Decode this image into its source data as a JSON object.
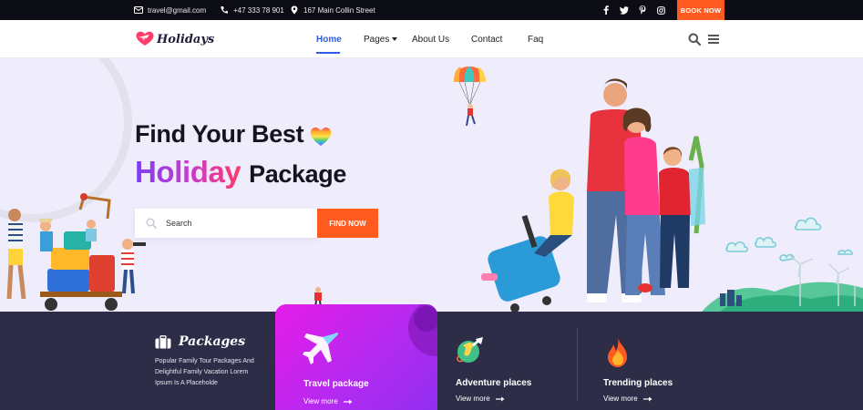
{
  "topbar": {
    "email": "travel@gmail.com",
    "phone": "+47 333 78 901",
    "address": "167 Main Collin Street",
    "social_icons": [
      "facebook-icon",
      "twitter-icon",
      "pinterest-icon",
      "instagram-icon"
    ],
    "book_label": "BOOK NOW"
  },
  "nav": {
    "logo_text": "Holidays",
    "links": [
      {
        "label": "Home",
        "active": true
      },
      {
        "label": "Pages",
        "has_dropdown": true
      },
      {
        "label": "About Us"
      },
      {
        "label": "Contact"
      },
      {
        "label": "Faq"
      }
    ]
  },
  "hero": {
    "line1": "Find Your Best",
    "highlight": "Holiday",
    "line2_rest": "Package",
    "search_placeholder": "Search",
    "find_label": "FIND NOW"
  },
  "packages": {
    "title": "Packages",
    "description": "Popular Family Tour Packages And Delightful Family Vacation Lorem Ipsum Is A Placeholde"
  },
  "features": [
    {
      "title": "Travel package",
      "more": "View more",
      "icon": "airplane-icon"
    },
    {
      "title": "Adventure places",
      "more": "View more",
      "icon": "globe-plane-icon"
    },
    {
      "title": "Trending places",
      "more": "View more",
      "icon": "fire-icon"
    }
  ],
  "colors": {
    "accent": "#ff5a1f",
    "nav_active": "#2c5ce0",
    "band_bg": "#2e2d48",
    "hero_bg": "#efedfb",
    "card_gradient_start": "#e61ce8",
    "card_gradient_end": "#8d2ff0"
  }
}
